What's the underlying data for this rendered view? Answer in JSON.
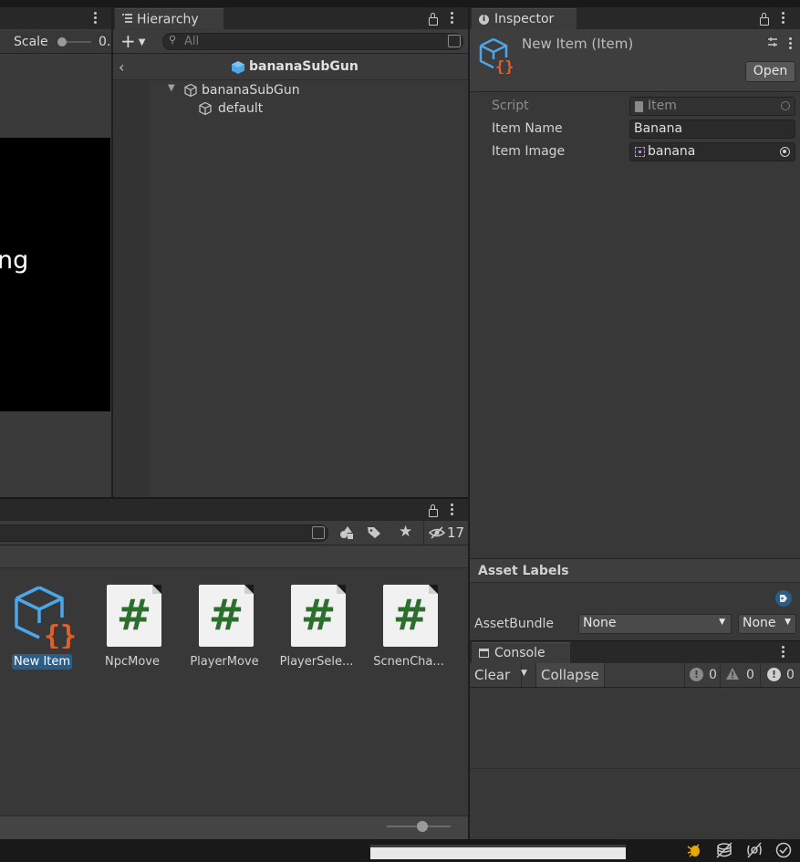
{
  "scene_panel": {
    "scale_label": "Scale",
    "scale_value": "0.",
    "overlay_text": "ng"
  },
  "hierarchy": {
    "tab_label": "Hierarchy",
    "add_label": "+",
    "search_placeholder": "All",
    "breadcrumb": "bananaSubGun",
    "items": [
      {
        "label": "bananaSubGun"
      },
      {
        "label": "default"
      }
    ]
  },
  "inspector": {
    "tab_label": "Inspector",
    "object_title": "New Item (Item)",
    "open_button": "Open",
    "fields": {
      "script_label": "Script",
      "script_value": "Item",
      "item_name_label": "Item Name",
      "item_name_value": "Banana",
      "item_image_label": "Item Image",
      "item_image_value": "banana"
    },
    "asset_labels_header": "Asset Labels",
    "assetbundle_label": "AssetBundle",
    "assetbundle_value": "None",
    "assetbundle_variant": "None"
  },
  "project": {
    "hidden_count": "17",
    "assets": [
      {
        "label": "New Item",
        "type": "scriptable-object",
        "selected": true
      },
      {
        "label": "NpcMove",
        "type": "cs-script"
      },
      {
        "label": "PlayerMove",
        "type": "cs-script"
      },
      {
        "label": "PlayerSele...",
        "type": "cs-script"
      },
      {
        "label": "ScnenCha...",
        "type": "cs-script"
      }
    ],
    "icon_size_slider": 0.7
  },
  "console": {
    "tab_label": "Console",
    "clear_label": "Clear",
    "collapse_label": "Collapse",
    "log_count": "0",
    "warning_count": "0",
    "error_count": "0"
  },
  "colors": {
    "accent_blue": "#4da6e8",
    "selection": "#2c5d87",
    "cs_green": "#2c6e2c",
    "brace_orange": "#e0602c"
  }
}
